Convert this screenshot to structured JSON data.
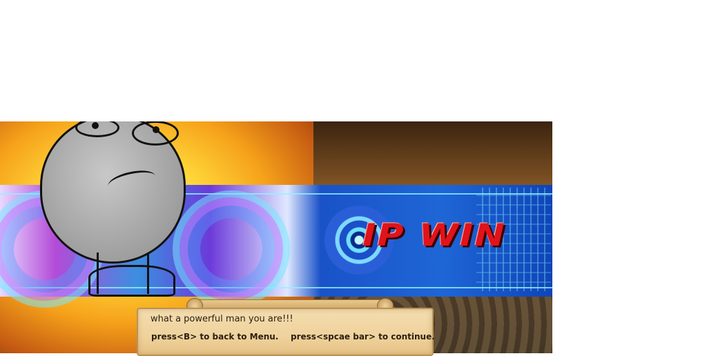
{
  "game": {
    "banner_title": "IP WIN"
  },
  "dialog": {
    "message": "what a powerful man you are!!!",
    "hint_back": "press<B> to back to Menu.",
    "hint_continue": "press<spcae bar> to continue."
  },
  "colors": {
    "title_red": "#e0141a",
    "banner_blue": "#1a52c8",
    "scroll_paper": "#f4ddb0"
  },
  "icons": [
    "meme-face-character",
    "target-emblem"
  ]
}
